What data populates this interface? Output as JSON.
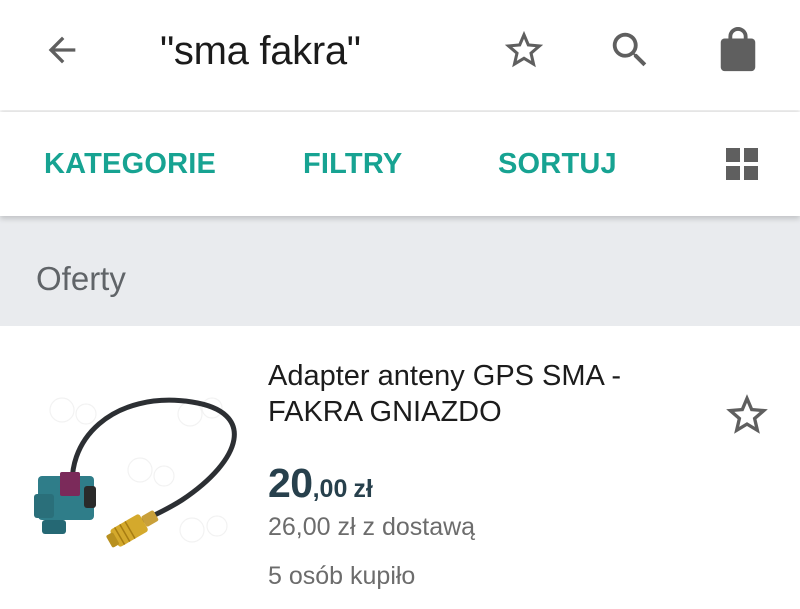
{
  "app_bar": {
    "search_query": "\"sma fakra\"",
    "icons": {
      "back": "arrow-back-icon",
      "favorite_search": "star-outline-icon",
      "search": "search-icon",
      "cart": "shopping-bag-icon"
    }
  },
  "toolbar": {
    "categories_label": "KATEGORIE",
    "filters_label": "FILTRY",
    "sort_label": "SORTUJ",
    "view_icon": "grid-view-icon"
  },
  "section": {
    "title": "Oferty"
  },
  "offers": [
    {
      "title": "Adapter anteny GPS SMA - FAKRA GNIAZDO",
      "price_main": "20",
      "price_decimal": ",00",
      "price_currency": "zł",
      "price_with_delivery": "26,00 zł z dostawą",
      "buyers": "5 osób kupiło",
      "favorite_icon": "star-outline-icon",
      "thumbnail_icon": "antenna-adapter-cable-image"
    }
  ],
  "colors": {
    "accent": "#17a392",
    "icon": "#5f5f5f",
    "price": "#27404c",
    "section_bg": "#e9ebee",
    "muted_text": "#6c6c6c"
  }
}
